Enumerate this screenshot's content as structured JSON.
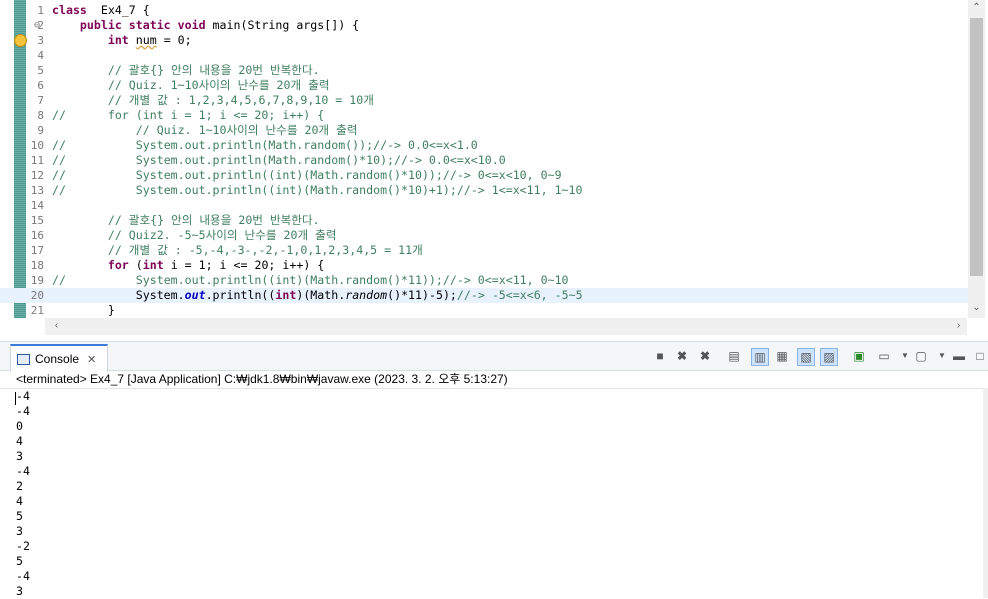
{
  "editor": {
    "lines": [
      {
        "n": "1",
        "fold": "",
        "code": [
          [
            "kw",
            "class"
          ],
          [
            "",
            "  Ex4_7 {"
          ]
        ]
      },
      {
        "n": "2",
        "fold": "⊖",
        "code": [
          [
            "",
            "    "
          ],
          [
            "kw",
            "public static void"
          ],
          [
            "",
            " main(String "
          ],
          [
            "",
            "args"
          ],
          [
            "",
            "[]) {"
          ]
        ]
      },
      {
        "n": "3",
        "fold": "",
        "warn": true,
        "code": [
          [
            "",
            "        "
          ],
          [
            "kw",
            "int"
          ],
          [
            "",
            " "
          ],
          [
            "sq",
            "num"
          ],
          [
            "",
            " = 0;"
          ]
        ]
      },
      {
        "n": "4",
        "fold": "",
        "code": []
      },
      {
        "n": "5",
        "fold": "",
        "code": [
          [
            "",
            "        "
          ],
          [
            "cm",
            "// 괄호{} 안의 내용을 20번 반복한다."
          ]
        ]
      },
      {
        "n": "6",
        "fold": "",
        "code": [
          [
            "",
            "        "
          ],
          [
            "cm",
            "// Quiz. 1~10사이의 난수를 20개 출력"
          ]
        ]
      },
      {
        "n": "7",
        "fold": "",
        "code": [
          [
            "",
            "        "
          ],
          [
            "cm",
            "// 개별 값 : 1,2,3,4,5,6,7,8,9,10 = 10개"
          ]
        ]
      },
      {
        "n": "8",
        "fold": "",
        "code": [
          [
            "cm",
            "//"
          ],
          [
            "cm",
            "      for (int i = 1; i <= 20; i++) {"
          ]
        ]
      },
      {
        "n": "9",
        "fold": "",
        "code": [
          [
            "",
            "            "
          ],
          [
            "cm",
            "// Quiz. 1~10사이의 난수를 20개 출력"
          ]
        ]
      },
      {
        "n": "10",
        "fold": "",
        "code": [
          [
            "cm",
            "//"
          ],
          [
            "cm",
            "          System.out.println(Math.random());//-> 0.0<=x<1.0"
          ]
        ]
      },
      {
        "n": "11",
        "fold": "",
        "code": [
          [
            "cm",
            "//"
          ],
          [
            "cm",
            "          System.out.println(Math.random()*10);//-> 0.0<=x<10.0"
          ]
        ]
      },
      {
        "n": "12",
        "fold": "",
        "code": [
          [
            "cm",
            "//"
          ],
          [
            "cm",
            "          System.out.println((int)(Math.random()*10));//-> 0<=x<10, 0~9"
          ]
        ]
      },
      {
        "n": "13",
        "fold": "",
        "code": [
          [
            "cm",
            "//"
          ],
          [
            "cm",
            "          System.out.println((int)(Math.random()*10)+1);//-> 1<=x<11, 1~10"
          ]
        ]
      },
      {
        "n": "14",
        "fold": "",
        "code": []
      },
      {
        "n": "15",
        "fold": "",
        "code": [
          [
            "",
            "        "
          ],
          [
            "cm",
            "// 괄호{} 안의 내용을 20번 반복한다."
          ]
        ]
      },
      {
        "n": "16",
        "fold": "",
        "code": [
          [
            "",
            "        "
          ],
          [
            "cm",
            "// Quiz2. -5~5사이의 난수를 20개 출력"
          ]
        ]
      },
      {
        "n": "17",
        "fold": "",
        "code": [
          [
            "",
            "        "
          ],
          [
            "cm",
            "// 개별 값 : -5,-4,-3-,-2,-1,0,1,2,3,4,5 = 11개"
          ]
        ]
      },
      {
        "n": "18",
        "fold": "",
        "code": [
          [
            "",
            "        "
          ],
          [
            "kw",
            "for"
          ],
          [
            "",
            " ("
          ],
          [
            "kw",
            "int"
          ],
          [
            "",
            " i = 1; i <= 20; i++) {"
          ]
        ]
      },
      {
        "n": "19",
        "fold": "",
        "code": [
          [
            "cm",
            "//"
          ],
          [
            "cm",
            "          System.out.println((int)(Math.random()*11));//-> 0<=x<11, 0~10"
          ]
        ]
      },
      {
        "n": "20",
        "fold": "",
        "current": true,
        "code": [
          [
            "",
            "            System."
          ],
          [
            "fld",
            "out"
          ],
          [
            "",
            ".println(("
          ],
          [
            "kw",
            "int"
          ],
          [
            "",
            ")(Math."
          ],
          [
            "it",
            "random"
          ],
          [
            "",
            "()*11)-5);"
          ],
          [
            "cm",
            "//-> -5<=x<6, -5~5"
          ]
        ]
      },
      {
        "n": "21",
        "fold": "",
        "code": [
          [
            "",
            "        }"
          ]
        ]
      }
    ]
  },
  "console": {
    "tab_label": "Console",
    "status": "<terminated> Ex4_7 [Java Application] C:₩jdk1.8₩bin₩javaw.exe (2023. 3. 2. 오후 5:13:27)",
    "output": [
      "-4",
      "-4",
      "0",
      "4",
      "3",
      "-4",
      "2",
      "4",
      "5",
      "3",
      "-2",
      "5",
      "-4",
      "3"
    ]
  },
  "icons": {
    "scroll_up": "⌃",
    "scroll_down": "⌄",
    "scroll_left": "‹",
    "scroll_right": "›",
    "tab_close": "✕"
  }
}
